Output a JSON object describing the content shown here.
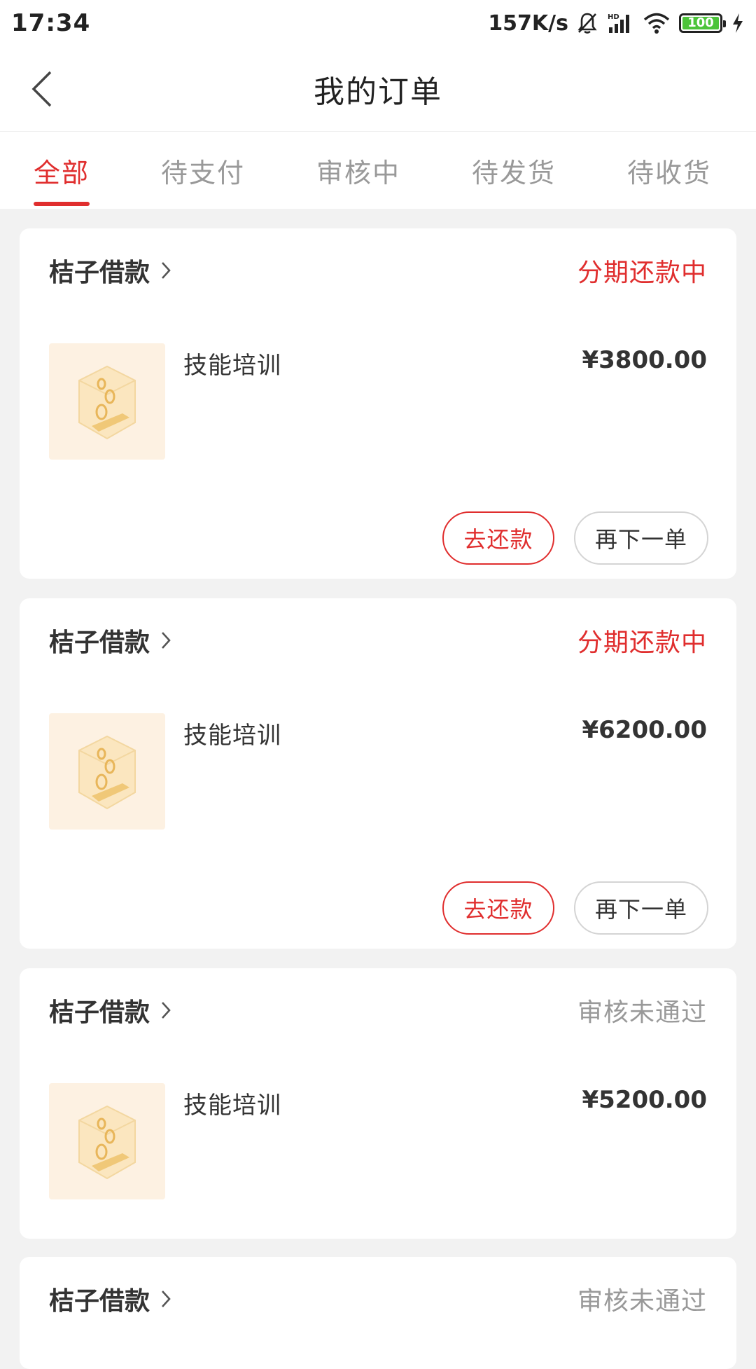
{
  "status_bar": {
    "time": "17:34",
    "net_speed": "157K/s",
    "battery": "100",
    "icons": [
      "mute-bell-icon",
      "hd-signal-icon",
      "wifi-icon",
      "battery-icon",
      "charging-icon"
    ]
  },
  "header": {
    "title": "我的订单",
    "back_icon": "chevron-left-icon"
  },
  "tabs": [
    {
      "label": "全部",
      "active": true
    },
    {
      "label": "待支付",
      "active": false
    },
    {
      "label": "审核中",
      "active": false
    },
    {
      "label": "待发货",
      "active": false
    },
    {
      "label": "待收货",
      "active": false
    }
  ],
  "orders": [
    {
      "store": "桔子借款",
      "status": "分期还款中",
      "product": "技能培训",
      "price": "¥3800.00",
      "repay_label": "去还款",
      "reorder_label": "再下一单"
    },
    {
      "store": "桔子借款",
      "status": "分期还款中",
      "product": "技能培训",
      "price": "¥6200.00",
      "repay_label": "去还款",
      "reorder_label": "再下一单"
    },
    {
      "store": "桔子借款",
      "status": "审核未通过",
      "product": "技能培训",
      "price": "¥5200.00"
    },
    {
      "store": "桔子借款",
      "status": "审核未通过"
    }
  ],
  "colors": {
    "accent": "#e02e2e",
    "muted": "#999999",
    "background": "#f2f2f2",
    "thumb_bg": "#fdf1e2"
  }
}
